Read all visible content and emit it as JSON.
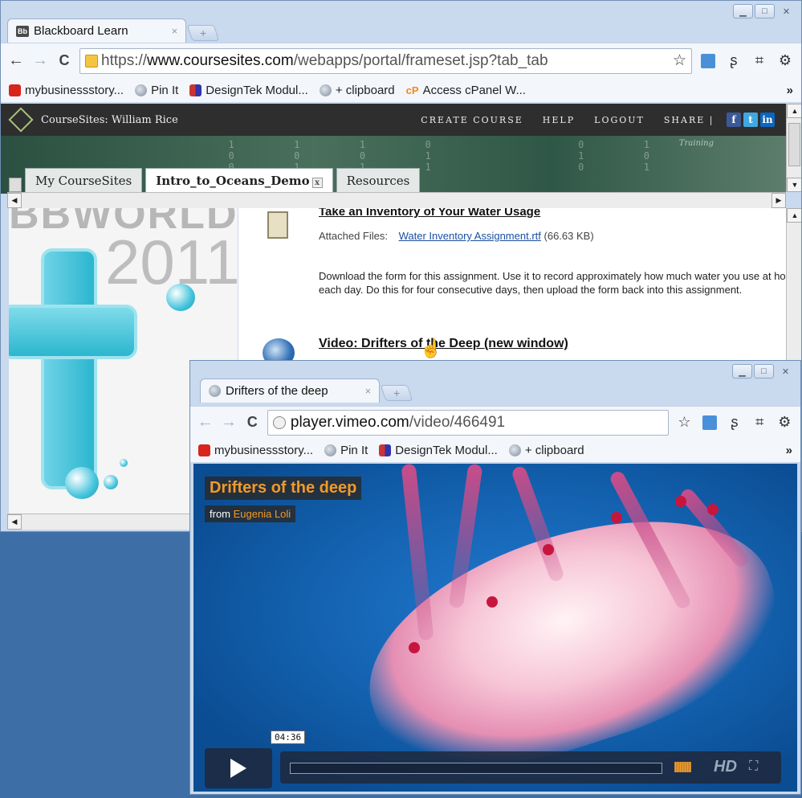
{
  "main_window": {
    "tab_title": "Blackboard Learn",
    "tab_favicon": "Bb",
    "url_scheme": "https://",
    "url_host": "www.coursesites.com",
    "url_path": "/webapps/portal/frameset.jsp?tab_tab",
    "bookmarks": [
      "mybusinessstory...",
      "Pin It",
      "DesignTek Modul...",
      "+ clipboard",
      "Access cPanel W..."
    ],
    "bookmark_cp_prefix": "cP",
    "more_chevron": "»"
  },
  "coursesites": {
    "title": "CourseSites: William Rice",
    "menu": [
      "CREATE COURSE",
      "HELP",
      "LOGOUT",
      "SHARE"
    ],
    "share_sep": "|",
    "social": [
      "f",
      "t",
      "in"
    ],
    "banner_training": "Training",
    "banner_digits": "1  1  1  0      0  1\n0  0  0  1      1  0\n0  1  1  1      0  1",
    "tabs": [
      "My CourseSites",
      "Intro_to_Oceans_Demo",
      "Resources"
    ],
    "tab_close": "x"
  },
  "left_image": {
    "text1": "BBWORLD",
    "text2": "2011"
  },
  "content": {
    "cut_title": "Take an Inventory of Your Water Usage",
    "attached_label": "Attached Files:",
    "attached_file": "Water Inventory Assignment.rtf",
    "attached_size": "(66.63 KB)",
    "description": "Download the form for this assignment. Use it to record approximately how much water you use at home each day. Do this for four consecutive days, then upload the form back into this assignment.",
    "video_link": "Video: Drifters of the Deep (new window)"
  },
  "popup": {
    "tab_title": "Drifters of the deep",
    "url_host": "player.vimeo.com",
    "url_path": "/video/466491",
    "bookmarks": [
      "mybusinessstory...",
      "Pin It",
      "DesignTek Modul...",
      "+ clipboard"
    ],
    "more_chevron": "»"
  },
  "player": {
    "title": "Drifters of the deep",
    "from_label": "from",
    "author": "Eugenia Loli",
    "timecode": "04:36",
    "progress_fraction": 0.0,
    "hd_label": "HD",
    "volume_glyph": "IIIIIII"
  },
  "icons": {
    "back": "←",
    "forward": "→",
    "reload": "C",
    "star": "☆",
    "wrench": "🔧",
    "play": "play-icon",
    "fullscreen": "⛶"
  },
  "colors": {
    "vimeo_orange": "#f29a28",
    "progress_blue": "#5aa9e6",
    "chrome_frame": "#c9d9ee"
  }
}
